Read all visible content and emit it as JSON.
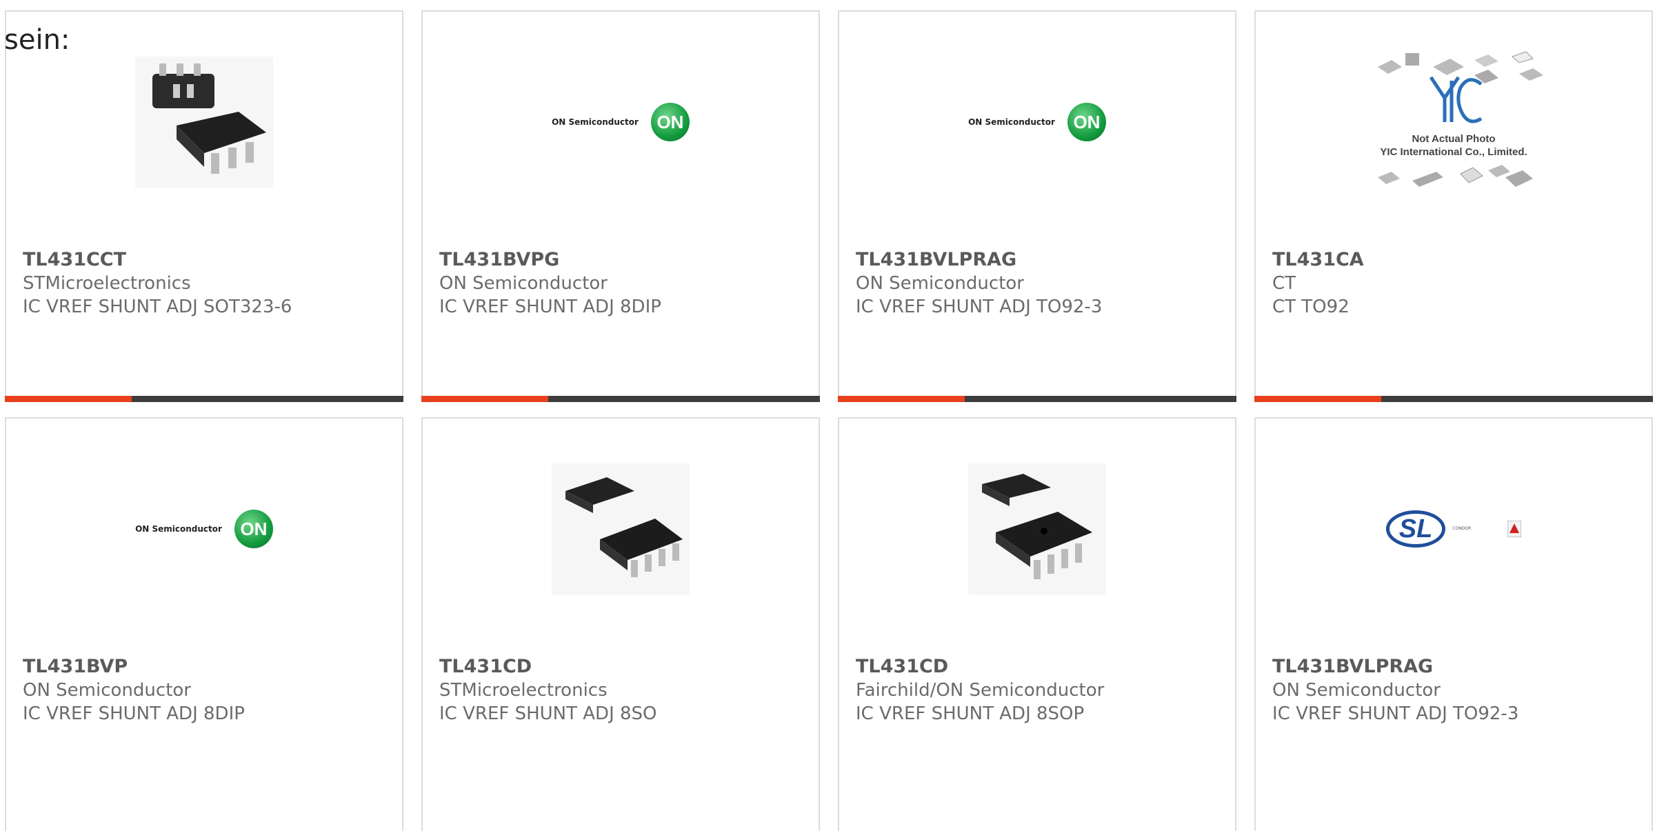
{
  "intro_text": "sein:",
  "colors": {
    "accent": "#e8401c",
    "bar": "#3d3d3d",
    "border": "#dcdcdc",
    "text": "#6b6b6b"
  },
  "image_labels": {
    "on_semi": "ON Semiconductor",
    "on_badge": "ON",
    "yic_line1": "Not Actual Photo",
    "yic_line2": "YIC International Co., Limited.",
    "sl_mark": "SL",
    "sl_side": "CONDOR"
  },
  "cards": [
    {
      "part": "TL431CCT",
      "maker": "STMicroelectronics",
      "desc": "IC VREF SHUNT ADJ SOT323-6",
      "image": "chip-sot323-icon"
    },
    {
      "part": "TL431BVPG",
      "maker": "ON Semiconductor",
      "desc": "IC VREF SHUNT ADJ 8DIP",
      "image": "on-semiconductor-logo"
    },
    {
      "part": "TL431BVLPRAG",
      "maker": "ON Semiconductor",
      "desc": "IC VREF SHUNT ADJ TO92-3",
      "image": "on-semiconductor-logo"
    },
    {
      "part": "TL431CA",
      "maker": "CT",
      "desc": "CT TO92",
      "image": "yic-placeholder"
    },
    {
      "part": "TL431BVP",
      "maker": "ON Semiconductor",
      "desc": "IC VREF SHUNT ADJ 8DIP",
      "image": "on-semiconductor-logo"
    },
    {
      "part": "TL431CD",
      "maker": "STMicroelectronics",
      "desc": "IC VREF SHUNT ADJ 8SO",
      "image": "chip-so8-icon"
    },
    {
      "part": "TL431CD",
      "maker": "Fairchild/ON Semiconductor",
      "desc": "IC VREF SHUNT ADJ 8SOP",
      "image": "chip-sop8-icon"
    },
    {
      "part": "TL431BVLPRAG",
      "maker": "ON Semiconductor",
      "desc": "IC VREF SHUNT ADJ TO92-3",
      "image": "sl-power-logo"
    }
  ]
}
